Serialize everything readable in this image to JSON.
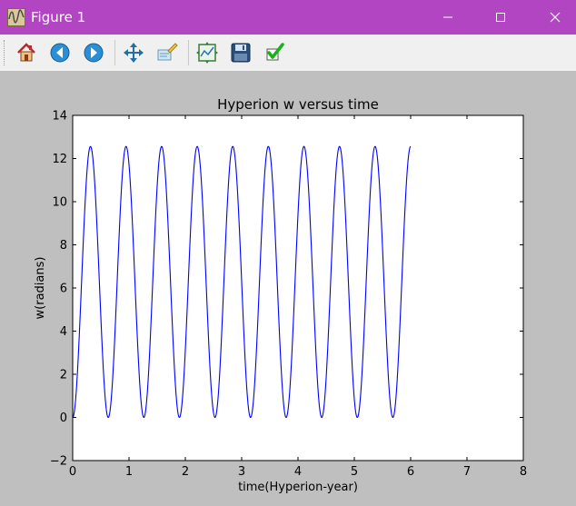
{
  "window": {
    "title": "Figure 1",
    "controls": {
      "minimize": "minimize",
      "maximize": "maximize",
      "close": "close"
    }
  },
  "toolbar": {
    "items": [
      {
        "name": "home",
        "icon": "home-icon"
      },
      {
        "name": "back",
        "icon": "arrow-left-icon"
      },
      {
        "name": "forward",
        "icon": "arrow-right-icon"
      },
      {
        "name": "pan",
        "icon": "move-icon"
      },
      {
        "name": "zoom",
        "icon": "zoom-rect-icon"
      },
      {
        "name": "subplots",
        "icon": "configure-subplots-icon"
      },
      {
        "name": "save",
        "icon": "floppy-disk-icon"
      },
      {
        "name": "edit",
        "icon": "checkmark-icon"
      }
    ]
  },
  "chart_data": {
    "type": "line",
    "title": "Hyperion w versus time",
    "xlabel": "time(Hyperion-year)",
    "ylabel": "w(radians)",
    "xlim": [
      0,
      8
    ],
    "ylim": [
      -2,
      14
    ],
    "xticks": [
      "0",
      "1",
      "2",
      "3",
      "4",
      "5",
      "6",
      "7",
      "8"
    ],
    "yticks": [
      "−2",
      "0",
      "2",
      "4",
      "6",
      "8",
      "10",
      "12",
      "14"
    ],
    "grid": false,
    "series": [
      {
        "color": "#0000ff",
        "function": "w(t) = 6.28 - 6.28*cos(2*pi*t/0.6316)",
        "amplitude": 6.28,
        "offset": 6.28,
        "period": 0.6316,
        "t_range": [
          0,
          6
        ],
        "samples": [
          [
            0.0,
            0.0
          ],
          [
            0.1579,
            6.28
          ],
          [
            0.3158,
            12.56
          ],
          [
            0.4737,
            6.28
          ],
          [
            0.6316,
            0.0
          ],
          [
            0.9474,
            12.56
          ],
          [
            1.2632,
            0.0
          ],
          [
            1.579,
            12.56
          ],
          [
            1.8948,
            0.0
          ],
          [
            2.2106,
            12.56
          ],
          [
            2.5264,
            0.0
          ],
          [
            2.8422,
            12.56
          ],
          [
            3.158,
            0.0
          ],
          [
            3.4738,
            12.56
          ],
          [
            3.7896,
            0.0
          ],
          [
            4.1054,
            12.56
          ],
          [
            4.4212,
            0.0
          ],
          [
            4.737,
            12.56
          ],
          [
            5.0528,
            0.0
          ],
          [
            5.3686,
            12.56
          ],
          [
            5.6844,
            0.0
          ],
          [
            6.0,
            11.55
          ]
        ]
      }
    ]
  }
}
